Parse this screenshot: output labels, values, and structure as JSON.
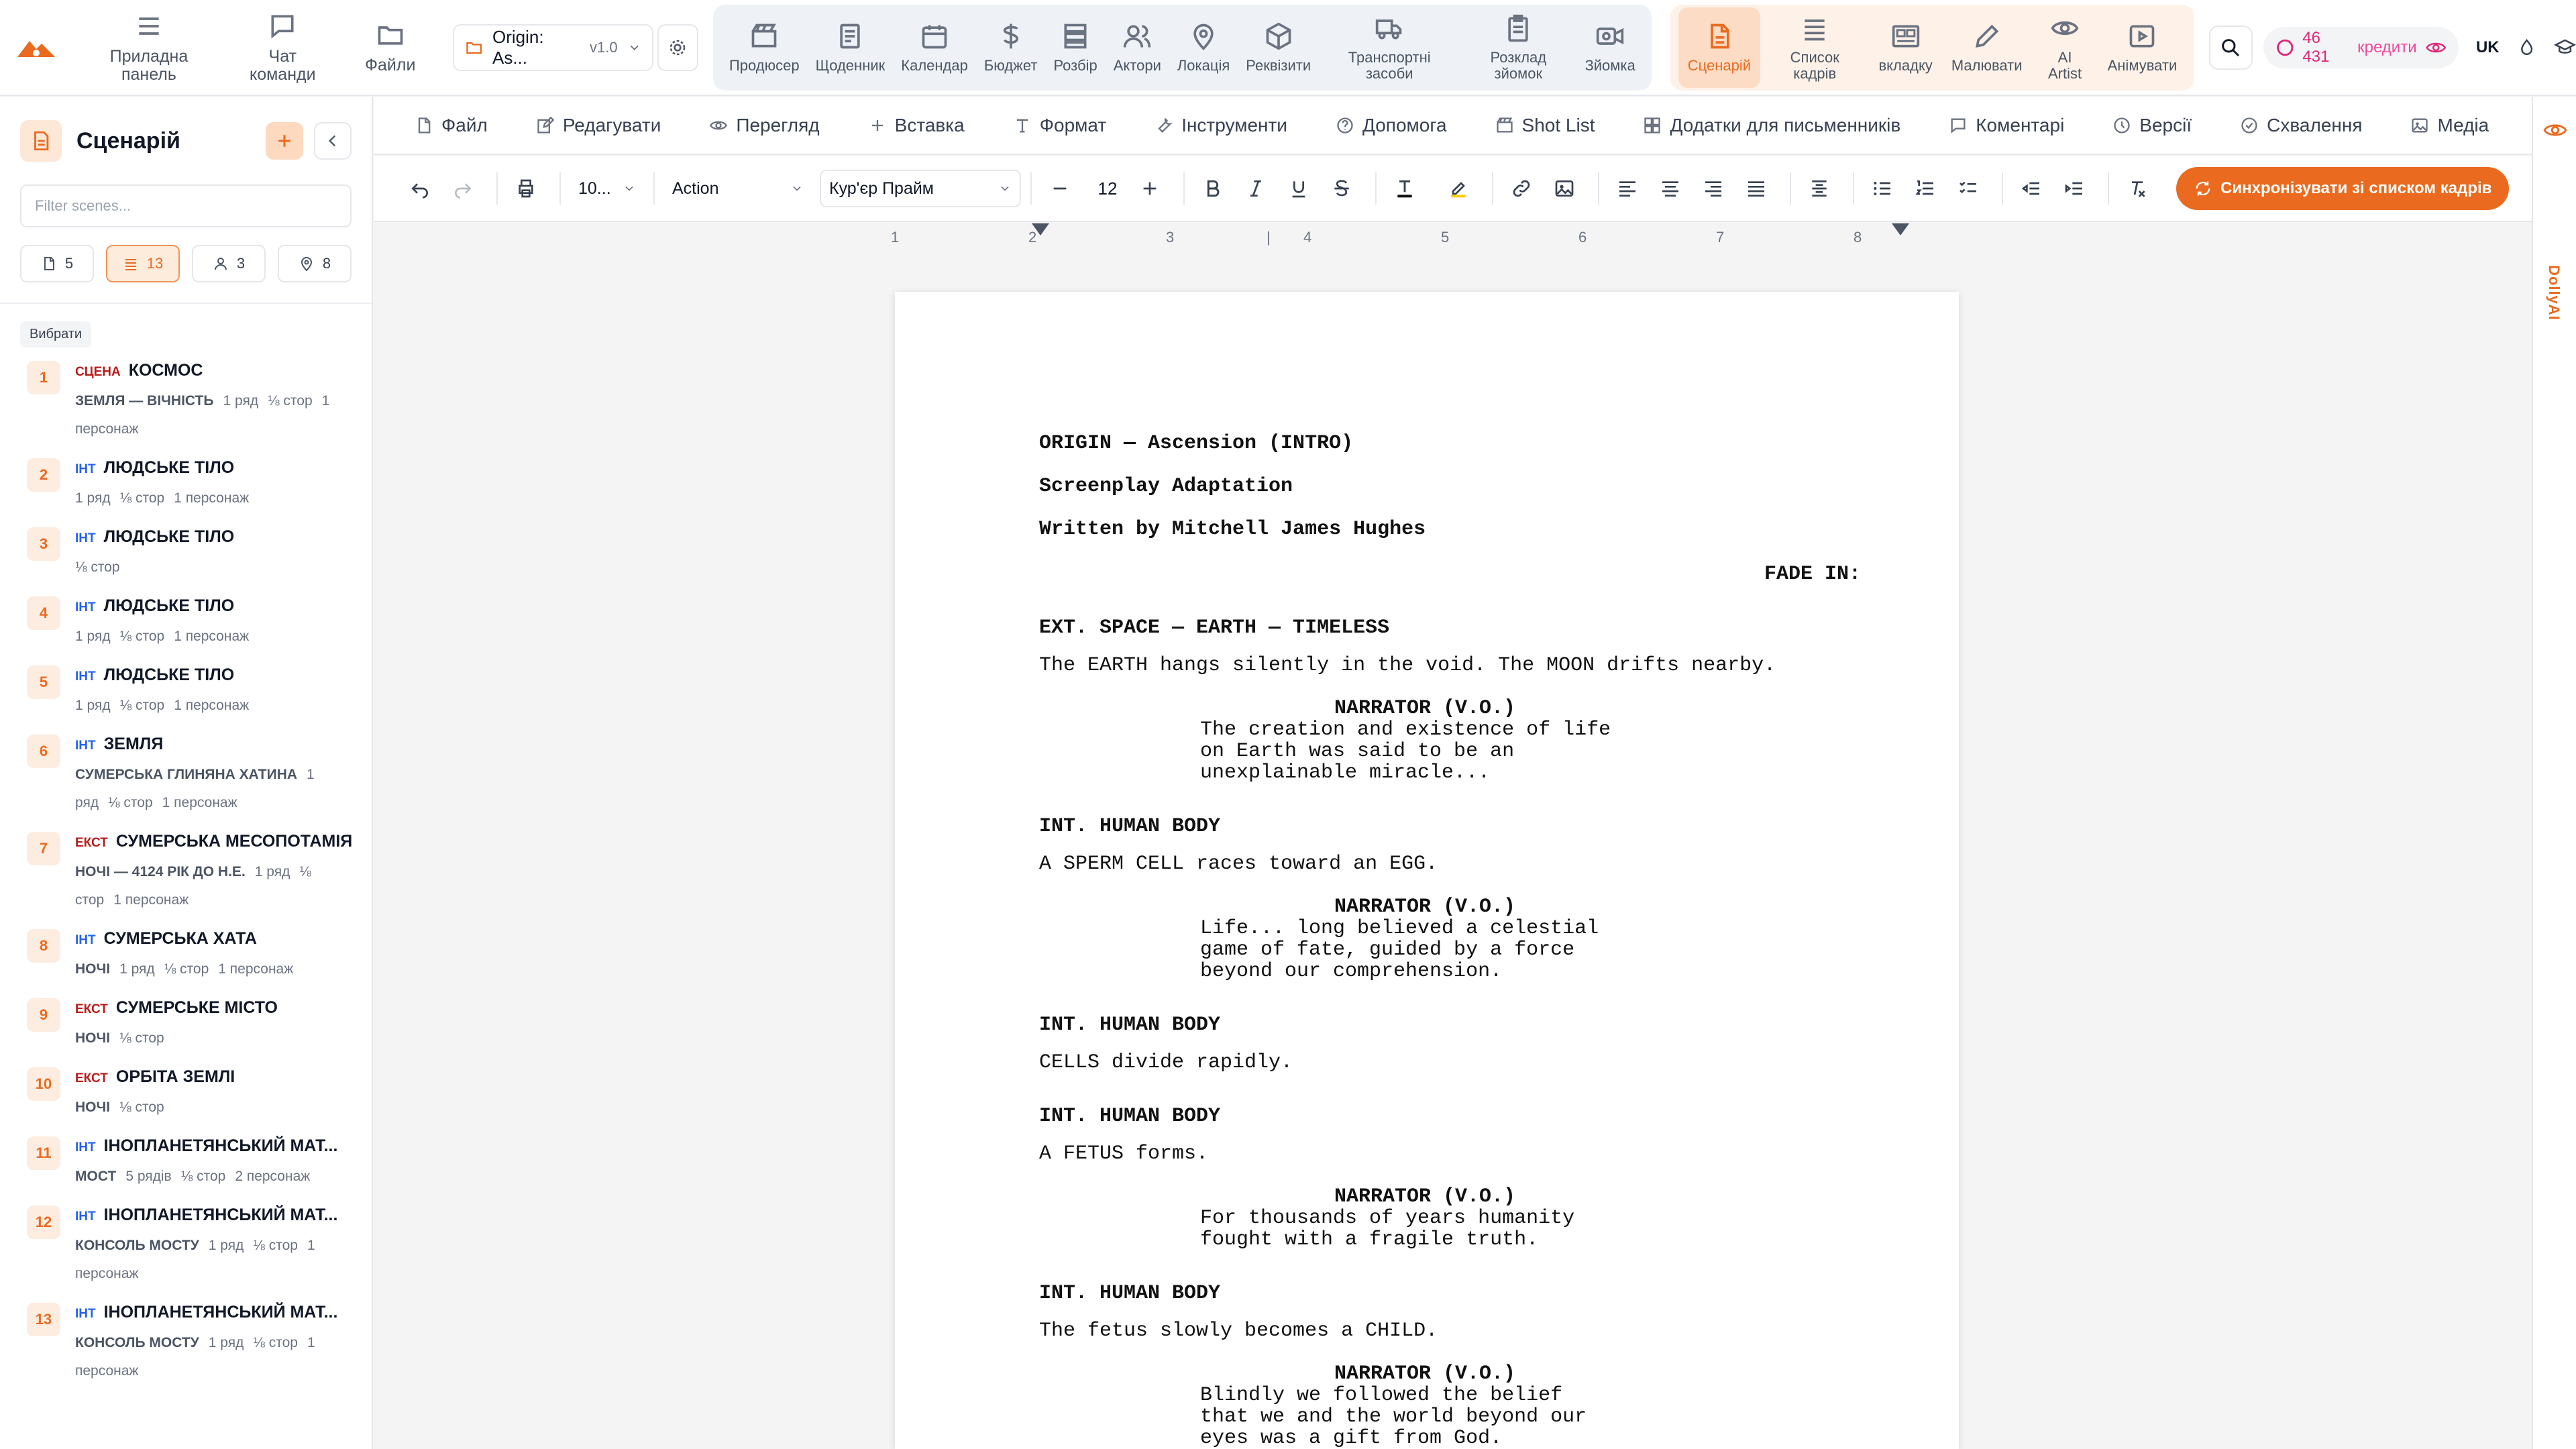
{
  "nav": {
    "main": [
      {
        "label": "Приладна панель",
        "icon": "menu-icon"
      },
      {
        "label": "Чат команди",
        "icon": "chat-icon"
      },
      {
        "label": "Файли",
        "icon": "folder-icon"
      }
    ],
    "project": {
      "name": "Origin: As...",
      "version": "v1.0"
    },
    "group1": [
      {
        "label": "Продюсер",
        "icon": "clapper-icon"
      },
      {
        "label": "Щоденник",
        "icon": "notebook-icon"
      },
      {
        "label": "Календар",
        "icon": "calendar-icon"
      },
      {
        "label": "Бюджет",
        "icon": "dollar-icon"
      },
      {
        "label": "Розбір",
        "icon": "stack-icon"
      },
      {
        "label": "Актори",
        "icon": "users-icon"
      },
      {
        "label": "Локація",
        "icon": "pin-icon"
      },
      {
        "label": "Реквізити",
        "icon": "box-icon"
      },
      {
        "label": "Транспортні засоби",
        "icon": "truck-icon"
      },
      {
        "label": "Розклад зйомок",
        "icon": "clipboard-icon"
      },
      {
        "label": "Зйомка",
        "icon": "camera-icon"
      }
    ],
    "group2": [
      {
        "label": "Сценарій",
        "icon": "document-icon",
        "active": true
      },
      {
        "label": "Список кадрів",
        "icon": "list-icon"
      },
      {
        "label": "вкладку",
        "icon": "storyboard-icon"
      },
      {
        "label": "Малювати",
        "icon": "pencil-icon"
      },
      {
        "label": "AI Artist",
        "icon": "eye-icon"
      },
      {
        "label": "Анімувати",
        "icon": "play-icon"
      }
    ],
    "credits_value": "46 431",
    "credits_label": "кредити",
    "lang": "UK"
  },
  "sidebar": {
    "title": "Сценарій",
    "filter_placeholder": "Filter scenes...",
    "counts": [
      {
        "value": "5",
        "icon": "page-icon"
      },
      {
        "value": "13",
        "icon": "list-icon",
        "active": true
      },
      {
        "value": "3",
        "icon": "user-icon"
      },
      {
        "value": "8",
        "icon": "pin-icon"
      }
    ],
    "choose_label": "Вибрати",
    "scenes": [
      {
        "num": "1",
        "tag": "СЦЕНА",
        "tagtype": "scn",
        "title": "КОСМОС",
        "loc": "ЗЕМЛЯ — ВІЧНІСТЬ",
        "meta": [
          "1 ряд",
          "⅛ стор",
          "1 персонаж"
        ]
      },
      {
        "num": "2",
        "tag": "ІНТ",
        "tagtype": "int",
        "title": "ЛЮДСЬКЕ ТІЛО",
        "loc": "",
        "meta": [
          "1 ряд",
          "⅛ стор",
          "1 персонаж"
        ]
      },
      {
        "num": "3",
        "tag": "ІНТ",
        "tagtype": "int",
        "title": "ЛЮДСЬКЕ ТІЛО",
        "loc": "",
        "meta": [
          "⅛ стор"
        ]
      },
      {
        "num": "4",
        "tag": "ІНТ",
        "tagtype": "int",
        "title": "ЛЮДСЬКЕ ТІЛО",
        "loc": "",
        "meta": [
          "1 ряд",
          "⅛ стор",
          "1 персонаж"
        ]
      },
      {
        "num": "5",
        "tag": "ІНТ",
        "tagtype": "int",
        "title": "ЛЮДСЬКЕ ТІЛО",
        "loc": "",
        "meta": [
          "1 ряд",
          "⅛ стор",
          "1 персонаж"
        ]
      },
      {
        "num": "6",
        "tag": "ІНТ",
        "tagtype": "int",
        "title": "ЗЕМЛЯ",
        "loc": "СУМЕРСЬКА ГЛИНЯНА ХАТИНА",
        "meta": [
          "1 ряд",
          "⅛ стор",
          "1 персонаж"
        ]
      },
      {
        "num": "7",
        "tag": "ЕКСТ",
        "tagtype": "ext",
        "title": "СУМЕРСЬКА МЕСОПОТАМІЯ",
        "loc": "НОЧІ — 4124 РІК ДО Н.Е.",
        "meta": [
          "1 ряд",
          "⅛ стор",
          "1 персонаж"
        ]
      },
      {
        "num": "8",
        "tag": "ІНТ",
        "tagtype": "int",
        "title": "СУМЕРСЬКА ХАТА",
        "loc": "НОЧІ",
        "meta": [
          "1 ряд",
          "⅛ стор",
          "1 персонаж"
        ]
      },
      {
        "num": "9",
        "tag": "ЕКСТ",
        "tagtype": "ext",
        "title": "СУМЕРСЬКЕ МІСТО",
        "loc": "НОЧІ",
        "meta": [
          "⅛ стор"
        ]
      },
      {
        "num": "10",
        "tag": "ЕКСТ",
        "tagtype": "ext",
        "title": "ОРБІТА ЗЕМЛІ",
        "loc": "НОЧІ",
        "meta": [
          "⅛ стор"
        ]
      },
      {
        "num": "11",
        "tag": "ІНТ",
        "tagtype": "int",
        "title": "ІНОПЛАНЕТЯНСЬКИЙ МАТ...",
        "loc": "МОСТ",
        "meta": [
          "5 рядів",
          "⅛ стор",
          "2 персонаж"
        ]
      },
      {
        "num": "12",
        "tag": "ІНТ",
        "tagtype": "int",
        "title": "ІНОПЛАНЕТЯНСЬКИЙ МАТ...",
        "loc": "КОНСОЛЬ МОСТУ",
        "meta": [
          "1 ряд",
          "⅛ стор",
          "1 персонаж"
        ]
      },
      {
        "num": "13",
        "tag": "ІНТ",
        "tagtype": "int",
        "title": "ІНОПЛАНЕТЯНСЬКИЙ МАТ...",
        "loc": "КОНСОЛЬ МОСТУ",
        "meta": [
          "1 ряд",
          "⅛ стор",
          "1 персонаж"
        ]
      }
    ]
  },
  "menu": [
    {
      "label": "Файл",
      "icon": "file-icon"
    },
    {
      "label": "Редагувати",
      "icon": "edit-icon"
    },
    {
      "label": "Перегляд",
      "icon": "eye-icon"
    },
    {
      "label": "Вставка",
      "icon": "plus-icon"
    },
    {
      "label": "Формат",
      "icon": "type-icon"
    },
    {
      "label": "Інструменти",
      "icon": "wrench-icon"
    },
    {
      "label": "Допомога",
      "icon": "help-icon"
    },
    {
      "label": "Shot List",
      "icon": "clapper-icon"
    },
    {
      "label": "Додатки для письменників",
      "icon": "grid-icon"
    },
    {
      "label": "Коментарі",
      "icon": "comment-icon"
    },
    {
      "label": "Версії",
      "icon": "clock-icon"
    },
    {
      "label": "Схвалення",
      "icon": "check-circle-icon"
    },
    {
      "label": "Медіа",
      "icon": "image-icon"
    }
  ],
  "toolbar": {
    "zoom": "10...",
    "element_type": "Action",
    "font": "Кур'єр Прайм",
    "font_size": "12",
    "sync_label": "Синхронізувати зі списком кадрів"
  },
  "ruler": [
    "1",
    "2",
    "3",
    "4",
    "5",
    "6",
    "7",
    "8"
  ],
  "script": [
    {
      "type": "title",
      "text": "ORIGIN — Ascension (INTRO)"
    },
    {
      "type": "title",
      "text": "Screenplay Adaptation"
    },
    {
      "type": "title",
      "text": "Written by Mitchell James Hughes"
    },
    {
      "type": "transition",
      "text": "FADE IN:"
    },
    {
      "type": "heading",
      "text": "EXT. SPACE — EARTH — TIMELESS"
    },
    {
      "type": "action",
      "text": "The EARTH hangs silently in the void. The MOON drifts nearby."
    },
    {
      "type": "character",
      "text": "NARRATOR (V.O.)"
    },
    {
      "type": "dialogue",
      "lines": [
        "The creation and existence of life",
        "on Earth was said to be an",
        "unexplainable miracle..."
      ]
    },
    {
      "type": "heading",
      "text": "INT. HUMAN BODY"
    },
    {
      "type": "action",
      "text": "A SPERM CELL races toward an EGG."
    },
    {
      "type": "character",
      "text": "NARRATOR (V.O.)"
    },
    {
      "type": "dialogue",
      "lines": [
        "Life... long believed a celestial",
        "game of fate, guided by a force",
        "beyond our comprehension."
      ]
    },
    {
      "type": "heading",
      "text": "INT. HUMAN BODY"
    },
    {
      "type": "action",
      "text": "CELLS divide rapidly."
    },
    {
      "type": "heading",
      "text": "INT. HUMAN BODY"
    },
    {
      "type": "action",
      "text": "A FETUS forms."
    },
    {
      "type": "character",
      "text": "NARRATOR (V.O.)"
    },
    {
      "type": "dialogue",
      "lines": [
        "For thousands of years humanity",
        "fought with a fragile truth."
      ]
    },
    {
      "type": "heading",
      "text": "INT. HUMAN BODY"
    },
    {
      "type": "action",
      "text": "The fetus slowly becomes a CHILD."
    },
    {
      "type": "character",
      "text": "NARRATOR (V.O.)"
    },
    {
      "type": "dialogue",
      "lines": [
        "Blindly we followed the belief",
        "that we and the world beyond our",
        "eyes was a gift from God."
      ]
    }
  ],
  "rail": {
    "label": "DollyAI"
  },
  "colors": {
    "accent": "#ea6a1f",
    "int": "#2563eb",
    "ext": "#b91c1c"
  }
}
